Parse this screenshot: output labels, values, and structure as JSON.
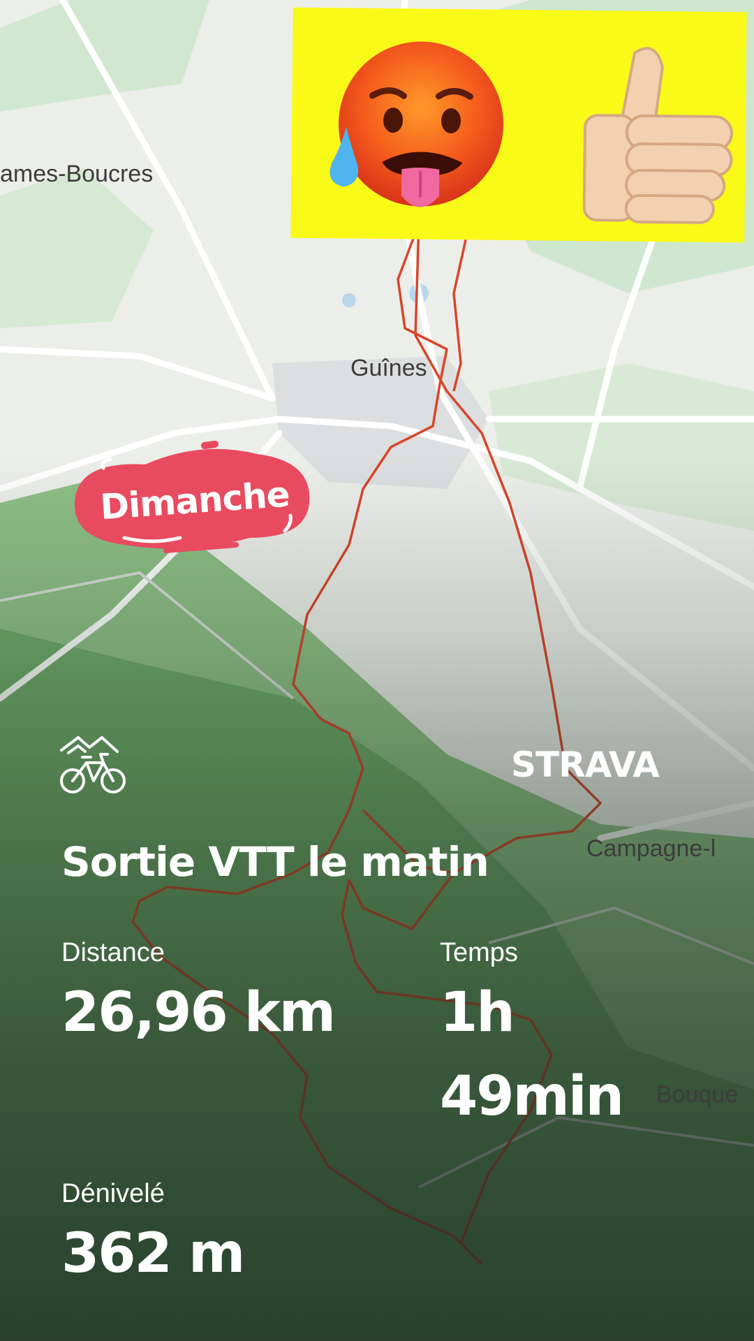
{
  "map": {
    "places": [
      {
        "name": "ames-Boucres"
      },
      {
        "name": "Guînes"
      },
      {
        "name": "Campagne-l"
      },
      {
        "name": "Bouque"
      }
    ]
  },
  "sticker": {
    "emoji_left": "hot-face-with-tongue",
    "emoji_right": "thumbs-up",
    "background_color": "#fafa18"
  },
  "tag": {
    "label": "Dimanche",
    "color": "#e84a5f"
  },
  "brand": {
    "label": "STRAVA"
  },
  "activity": {
    "icon": "mountain-bike-icon",
    "title": "Sortie VTT le matin",
    "stats": {
      "distance": {
        "label": "Distance",
        "value": "26,96 km"
      },
      "time": {
        "label": "Temps",
        "value_line1": "1h",
        "value_line2": "49min"
      },
      "elevation": {
        "label": "Dénivelé",
        "value": "362 m"
      }
    }
  },
  "route_color": "#d9452a"
}
